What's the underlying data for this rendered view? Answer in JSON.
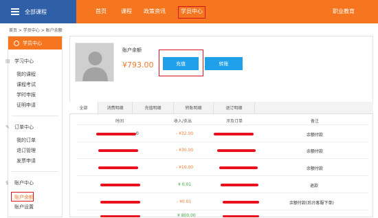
{
  "topbar": {
    "all_courses": "全部课程",
    "nav": [
      "首页",
      "课程",
      "政策资讯",
      "学员中心"
    ],
    "right": "职业教育",
    "accent": "#f5761e",
    "brand_blue": "#2f5fa7"
  },
  "breadcrumb": "首页 > 学员中心 > 账户余额",
  "sidebar": {
    "header": "学员中心",
    "groups": [
      {
        "title": "学习中心",
        "items": [
          "我的课程",
          "课程考试",
          "学时申报",
          "证明申请"
        ]
      },
      {
        "title": "订单中心",
        "items": [
          "我的订单",
          "退订管理",
          "发票申请"
        ]
      },
      {
        "title": "账户中心",
        "items": [
          "账户余额",
          "账户设置"
        ]
      }
    ]
  },
  "account": {
    "balance_label": "账户余额",
    "balance": "¥793.00",
    "recharge": "充值",
    "transfer": "转账"
  },
  "tabs": [
    "全部",
    "消费明细",
    "充值明细",
    "转账明细",
    "退订明细"
  ],
  "table": {
    "headers": [
      "时间",
      "收入/支出",
      "涉及订单",
      "备注"
    ],
    "rows": [
      {
        "time_tail": "0",
        "amount": "- ¥32.00",
        "type": "neg",
        "note": "余额付款"
      },
      {
        "time_tail": "",
        "amount": "- ¥30.00",
        "type": "neg",
        "note": "余额付款"
      },
      {
        "time_tail": "",
        "amount": "- ¥10.00",
        "type": "neg",
        "note": "余额付款"
      },
      {
        "time_tail": "",
        "amount": "¥ 0.01",
        "type": "pos",
        "note": "退款"
      },
      {
        "time_tail": "",
        "amount": "- ¥0.01",
        "type": "neg",
        "note": "余额付款(后台客服下单)"
      },
      {
        "time_tail": "",
        "amount": "¥ 800.00",
        "type": "pos",
        "note": ""
      }
    ]
  }
}
